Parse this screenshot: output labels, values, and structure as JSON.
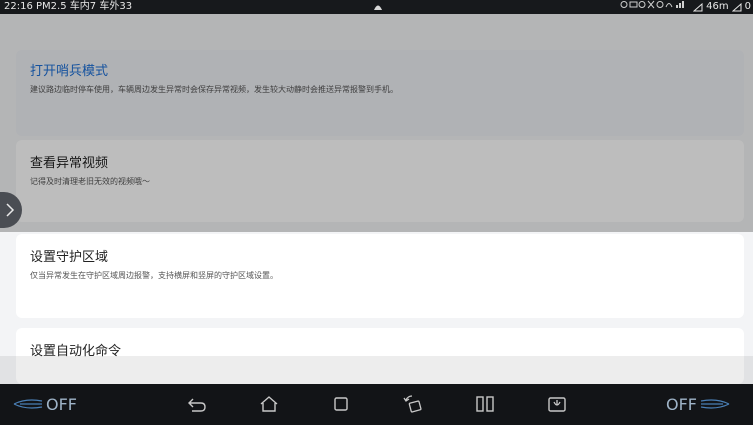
{
  "status_bar": {
    "time": "22:16",
    "pm25": "PM2.5",
    "inside": "车内7",
    "outside": "车外33",
    "speed": "46m",
    "battery": "0"
  },
  "cards": [
    {
      "title": "打开哨兵模式",
      "description": "建议路边临时停车使用，车辆周边发生异常时会保存异常视频，发生较大动静时会推送异常报警到手机。"
    },
    {
      "title": "查看异常视频",
      "description": "记得及时清理老旧无效的视频哦～"
    },
    {
      "title": "设置守护区域",
      "description": "仅当异常发生在守护区域周边报警，支持横屏和竖屏的守护区域设置。"
    },
    {
      "title": "设置自动化命令",
      "description": ""
    }
  ],
  "navbar": {
    "left_fan": "OFF",
    "right_fan": "OFF"
  },
  "colors": {
    "accent": "#1d6fd6",
    "background": "#f3f4f6",
    "bar": "#121417"
  }
}
